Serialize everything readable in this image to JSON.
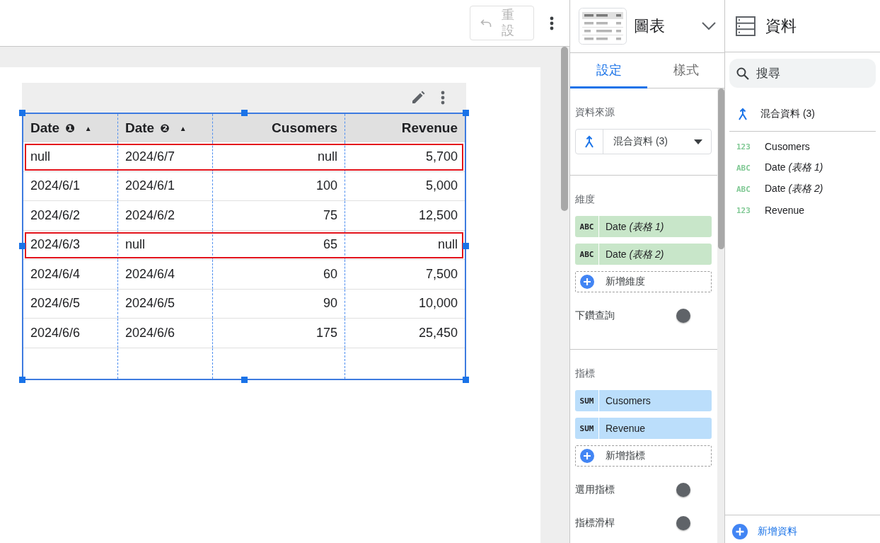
{
  "toolbar": {
    "reset_button": {
      "label": "重設",
      "disabled": true
    }
  },
  "table": {
    "columns": [
      {
        "label": "Date",
        "badge": "❶",
        "sort": "▲",
        "kind": "dimension"
      },
      {
        "label": "Date",
        "badge": "❷",
        "sort": "▲",
        "kind": "dimension"
      },
      {
        "label": "Cusomers",
        "kind": "metric"
      },
      {
        "label": "Revenue",
        "kind": "metric"
      }
    ],
    "rows": [
      {
        "cells": [
          "null",
          "2024/6/7",
          "null",
          "5,700"
        ],
        "highlighted": true
      },
      {
        "cells": [
          "2024/6/1",
          "2024/6/1",
          "100",
          "5,000"
        ],
        "highlighted": false
      },
      {
        "cells": [
          "2024/6/2",
          "2024/6/2",
          "75",
          "12,500"
        ],
        "highlighted": false
      },
      {
        "cells": [
          "2024/6/3",
          "null",
          "65",
          "null"
        ],
        "highlighted": true
      },
      {
        "cells": [
          "2024/6/4",
          "2024/6/4",
          "60",
          "7,500"
        ],
        "highlighted": false
      },
      {
        "cells": [
          "2024/6/5",
          "2024/6/5",
          "90",
          "10,000"
        ],
        "highlighted": false
      },
      {
        "cells": [
          "2024/6/6",
          "2024/6/6",
          "175",
          "25,450"
        ],
        "highlighted": false
      }
    ]
  },
  "chart_panel": {
    "title": "圖表",
    "tabs": [
      {
        "label": "設定",
        "selected": true
      },
      {
        "label": "樣式",
        "selected": false
      }
    ],
    "data_source": {
      "label": "資料來源",
      "value": "混合資料 (3)"
    },
    "dimensions": {
      "label": "維度",
      "chips": [
        {
          "kind": "dimension",
          "tag": "ABC",
          "field": "Date *(表格 1)*"
        },
        {
          "kind": "dimension",
          "tag": "ABC",
          "field": "Date *(表格 2)*"
        }
      ],
      "add_label": "新增維度"
    },
    "drill_down": {
      "label": "下鑽查詢",
      "on": false
    },
    "metrics": {
      "label": "指標",
      "chips": [
        {
          "kind": "metric",
          "tag": "SUM",
          "field": "Cusomers"
        },
        {
          "kind": "metric",
          "tag": "SUM",
          "field": "Revenue"
        }
      ],
      "add_label": "新增指標"
    },
    "toggles": [
      {
        "label": "選用指標",
        "on": false
      },
      {
        "label": "指標滑桿",
        "on": false
      }
    ]
  },
  "data_panel": {
    "title": "資料",
    "search": {
      "placeholder": "搜尋"
    },
    "source": "混合資料 (3)",
    "fields": [
      {
        "type": "123",
        "name": "Cusomers"
      },
      {
        "type": "ABC",
        "name": "Date *(表格 1)*"
      },
      {
        "type": "ABC",
        "name": "Date *(表格 2)*"
      },
      {
        "type": "123",
        "name": "Revenue"
      }
    ],
    "add_label": "新增資料"
  }
}
